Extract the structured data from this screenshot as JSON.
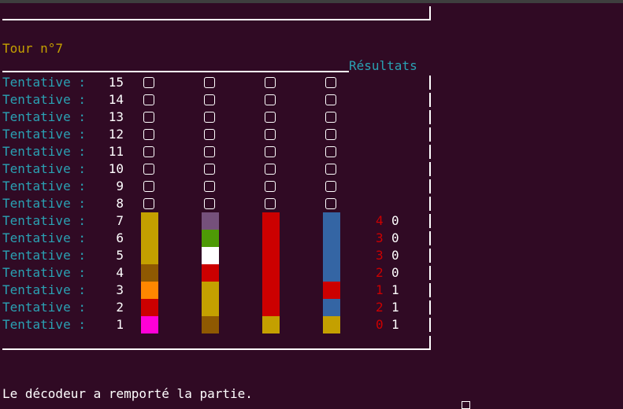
{
  "game": {
    "turn_label": "Tour n°7",
    "results_header": "Résultats",
    "attempt_label": "Tentative :",
    "status_message": "Le décodeur a remporté la partie."
  },
  "colors": {
    "background": "#300a24",
    "label": "#2aa1b3",
    "turn": "#c4a000",
    "correct_place": "#cc0000",
    "misplaced": "#ffffff",
    "yellow": "#c4a000",
    "purple": "#75507b",
    "green": "#4e9a06",
    "white": "#ffffff",
    "red": "#cc0000",
    "blue": "#3465a4",
    "brown": "#8f5902",
    "orange": "#ff8700",
    "magenta": "#ff00d7"
  },
  "board": {
    "rows": [
      {
        "number": "15",
        "pegs": [
          null,
          null,
          null,
          null
        ],
        "result_red": "",
        "result_white": ""
      },
      {
        "number": "14",
        "pegs": [
          null,
          null,
          null,
          null
        ],
        "result_red": "",
        "result_white": ""
      },
      {
        "number": "13",
        "pegs": [
          null,
          null,
          null,
          null
        ],
        "result_red": "",
        "result_white": ""
      },
      {
        "number": "12",
        "pegs": [
          null,
          null,
          null,
          null
        ],
        "result_red": "",
        "result_white": ""
      },
      {
        "number": "11",
        "pegs": [
          null,
          null,
          null,
          null
        ],
        "result_red": "",
        "result_white": ""
      },
      {
        "number": "10",
        "pegs": [
          null,
          null,
          null,
          null
        ],
        "result_red": "",
        "result_white": ""
      },
      {
        "number": "9",
        "pegs": [
          null,
          null,
          null,
          null
        ],
        "result_red": "",
        "result_white": ""
      },
      {
        "number": "8",
        "pegs": [
          null,
          null,
          null,
          null
        ],
        "result_red": "",
        "result_white": ""
      },
      {
        "number": "7",
        "pegs": [
          "yellow",
          "purple",
          "red",
          "blue"
        ],
        "result_red": "4",
        "result_white": "0"
      },
      {
        "number": "6",
        "pegs": [
          "yellow",
          "green",
          "red",
          "blue"
        ],
        "result_red": "3",
        "result_white": "0"
      },
      {
        "number": "5",
        "pegs": [
          "yellow",
          "white",
          "red",
          "blue"
        ],
        "result_red": "3",
        "result_white": "0"
      },
      {
        "number": "4",
        "pegs": [
          "brown",
          "red",
          "red",
          "blue"
        ],
        "result_red": "2",
        "result_white": "0"
      },
      {
        "number": "3",
        "pegs": [
          "orange",
          "yellow",
          "red",
          "red"
        ],
        "result_red": "1",
        "result_white": "1"
      },
      {
        "number": "2",
        "pegs": [
          "red",
          "yellow",
          "red",
          "blue"
        ],
        "result_red": "2",
        "result_white": "1"
      },
      {
        "number": "1",
        "pegs": [
          "magenta",
          "brown",
          "yellow",
          "yellow"
        ],
        "result_red": "0",
        "result_white": "1"
      }
    ]
  }
}
